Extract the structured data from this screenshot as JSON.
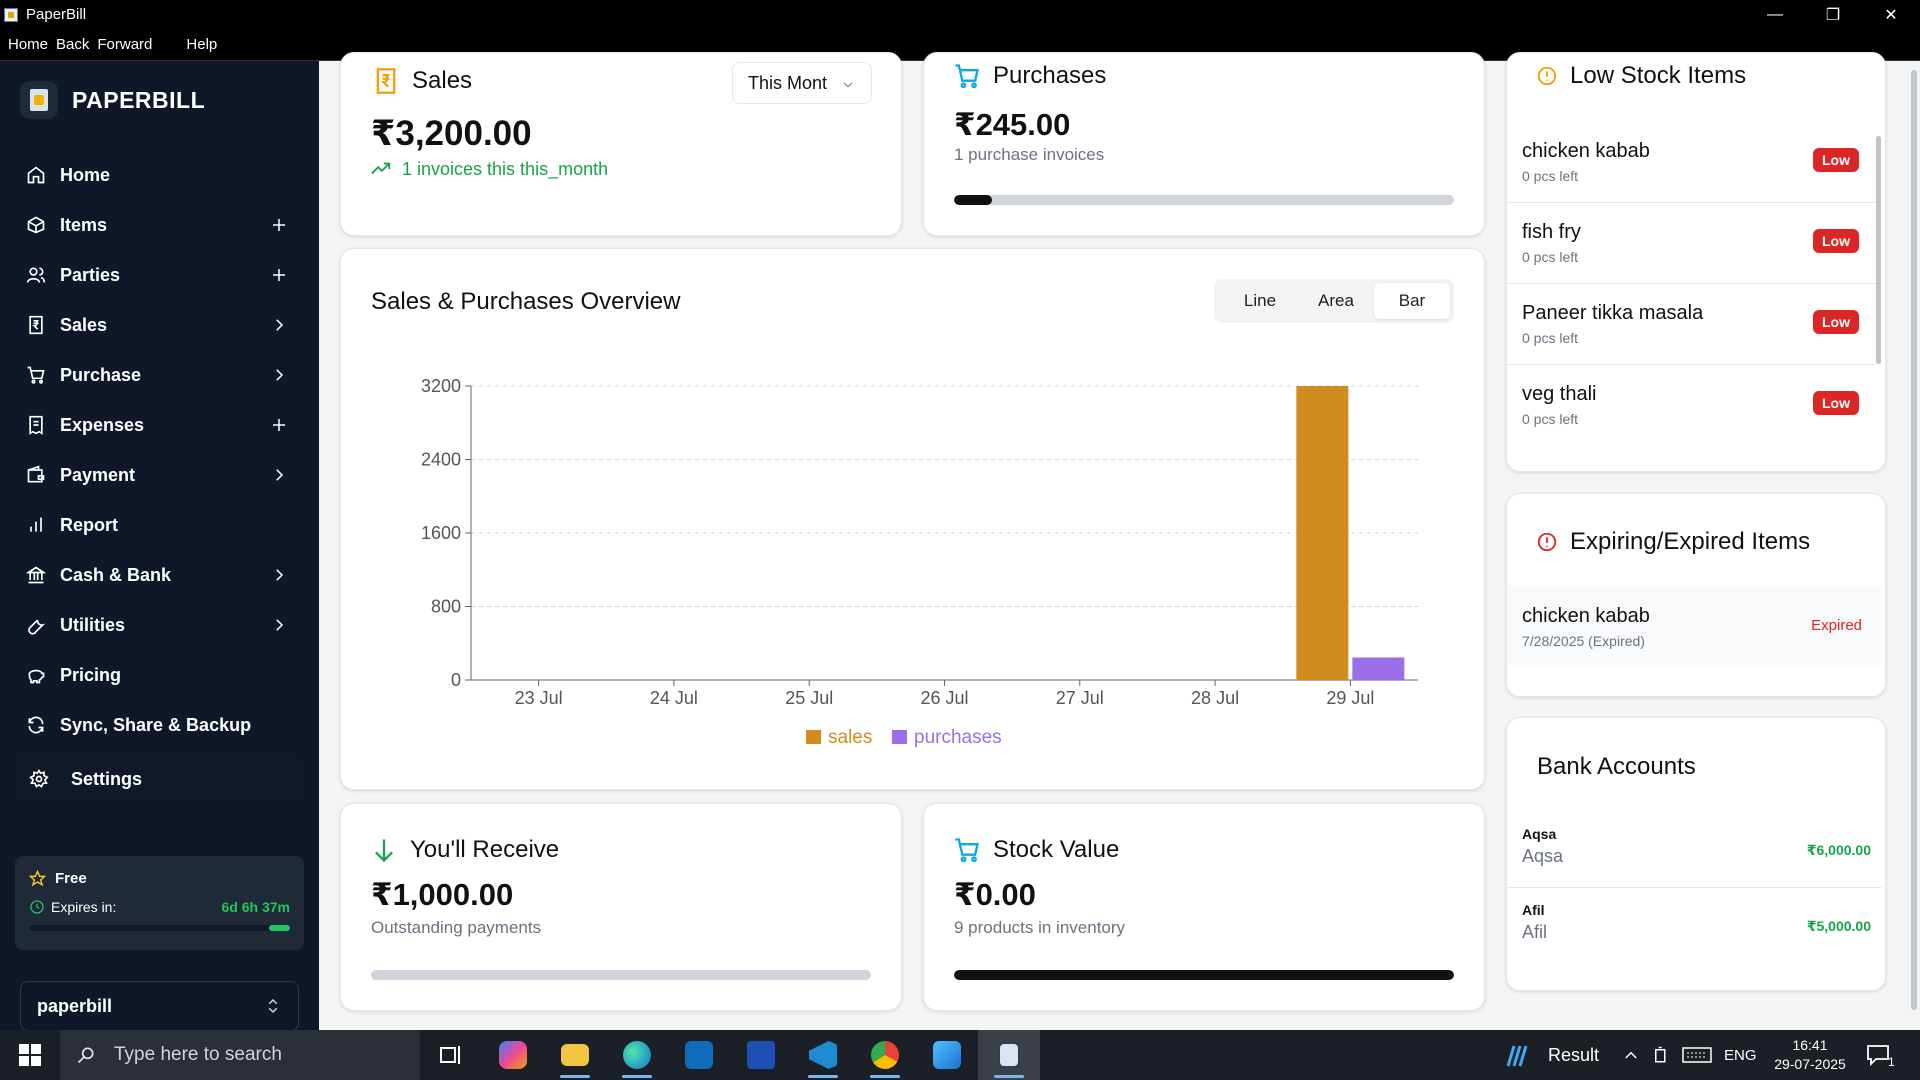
{
  "window": {
    "title": "PaperBill",
    "minimize_glyph": "—",
    "maximize_glyph": "❐",
    "close_glyph": "✕"
  },
  "menubar": {
    "items": [
      "Home",
      "Back",
      "Forward",
      "Help"
    ]
  },
  "sidebar": {
    "brand": "PAPERBILL",
    "items": [
      {
        "label": "Home",
        "icon": "home-icon",
        "trail": ""
      },
      {
        "label": "Items",
        "icon": "box-icon",
        "trail": "plus"
      },
      {
        "label": "Parties",
        "icon": "users-icon",
        "trail": "plus"
      },
      {
        "label": "Sales",
        "icon": "receipt-rupee-icon",
        "trail": "chevron"
      },
      {
        "label": "Purchase",
        "icon": "cart-icon",
        "trail": "chevron"
      },
      {
        "label": "Expenses",
        "icon": "receipt-icon",
        "trail": "plus"
      },
      {
        "label": "Payment",
        "icon": "wallet-icon",
        "trail": "chevron"
      },
      {
        "label": "Report",
        "icon": "bar-chart-icon",
        "trail": ""
      },
      {
        "label": "Cash & Bank",
        "icon": "bank-icon",
        "trail": "chevron"
      },
      {
        "label": "Utilities",
        "icon": "wrench-icon",
        "trail": "chevron"
      },
      {
        "label": "Pricing",
        "icon": "piggy-bank-icon",
        "trail": ""
      },
      {
        "label": "Sync, Share & Backup",
        "icon": "refresh-icon",
        "trail": ""
      },
      {
        "label": "Settings",
        "icon": "gear-icon",
        "trail": ""
      }
    ],
    "plan": {
      "name": "Free",
      "expires_label": "Expires in:",
      "expires_value": "6d 6h 37m",
      "remaining_fraction": 0.08
    },
    "company": "paperbill"
  },
  "sales_card": {
    "title": "Sales",
    "period": "This Mont",
    "amount": "₹3,200.00",
    "trend": "1 invoices this this_month"
  },
  "purchases_card": {
    "title": "Purchases",
    "amount": "₹245.00",
    "subtitle": "1 purchase invoices",
    "progress_fraction": 0.075
  },
  "overview": {
    "title": "Sales & Purchases Overview",
    "view_options": [
      "Line",
      "Area",
      "Bar"
    ],
    "selected_view": "Bar"
  },
  "chart_data": {
    "type": "bar",
    "categories": [
      "23 Jul",
      "24 Jul",
      "25 Jul",
      "26 Jul",
      "27 Jul",
      "28 Jul",
      "29 Jul"
    ],
    "series": [
      {
        "name": "sales",
        "color": "#d08c1e",
        "values": [
          0,
          0,
          0,
          0,
          0,
          0,
          3200
        ]
      },
      {
        "name": "purchases",
        "color": "#9b6fe8",
        "values": [
          0,
          0,
          0,
          0,
          0,
          0,
          245
        ]
      }
    ],
    "yticks": [
      0,
      800,
      1600,
      2400,
      3200
    ],
    "ylim": [
      0,
      3200
    ],
    "grid": true,
    "legend": "bottom"
  },
  "receive_card": {
    "title": "You'll Receive",
    "amount": "₹1,000.00",
    "subtitle": "Outstanding payments",
    "progress_fraction": 0
  },
  "stock_value_card": {
    "title": "Stock Value",
    "amount": "₹0.00",
    "subtitle": "9 products in inventory",
    "progress_fraction": 1
  },
  "low_stock": {
    "title": "Low Stock Items",
    "items": [
      {
        "name": "chicken kabab",
        "left": "0 pcs left",
        "badge": "Low"
      },
      {
        "name": "fish fry",
        "left": "0 pcs left",
        "badge": "Low"
      },
      {
        "name": "Paneer tikka masala",
        "left": "0 pcs left",
        "badge": "Low"
      },
      {
        "name": "veg thali",
        "left": "0 pcs left",
        "badge": "Low"
      }
    ]
  },
  "expiring": {
    "title": "Expiring/Expired Items",
    "items": [
      {
        "name": "chicken kabab",
        "date": "7/28/2025 (Expired)",
        "status": "Expired"
      }
    ]
  },
  "bank_accounts": {
    "title": "Bank Accounts",
    "accounts": [
      {
        "name": "Aqsa",
        "holder": "Aqsa",
        "balance": "₹6,000.00"
      },
      {
        "name": "Afil",
        "holder": "Afil",
        "balance": "₹5,000.00"
      }
    ]
  },
  "taskbar": {
    "search_placeholder": "Type here to search",
    "weather": "Result",
    "language": "ENG",
    "time": "16:41",
    "date": "29-07-2025",
    "notification_count": "1"
  }
}
